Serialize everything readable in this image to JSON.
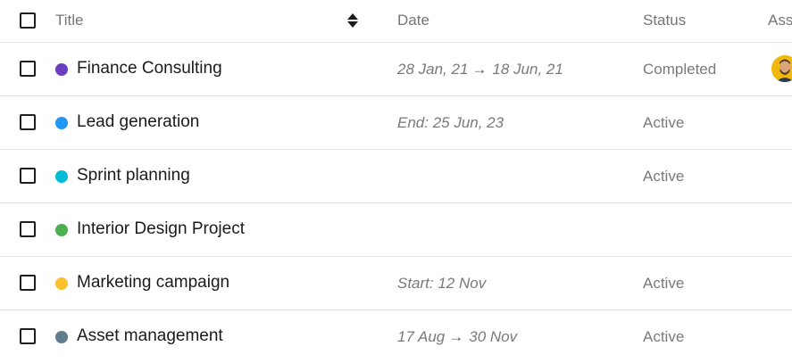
{
  "columns": {
    "title": "Title",
    "date": "Date",
    "status": "Status",
    "assignee": "Ass"
  },
  "rows": [
    {
      "title": "Finance Consulting",
      "dot_color": "#6a3fc1",
      "date_start": "28 Jan, 21",
      "date_arrow": "→",
      "date_end": "18 Jun, 21",
      "status": "Completed",
      "has_avatar": true
    },
    {
      "title": "Lead generation",
      "dot_color": "#2196f3",
      "date_text": "End: 25 Jun, 23",
      "status": "Active"
    },
    {
      "title": "Sprint planning",
      "dot_color": "#00bcd4",
      "status": "Active"
    },
    {
      "title": "Interior Design Project",
      "dot_color": "#4caf50"
    },
    {
      "title": "Marketing campaign",
      "dot_color": "#fbc02d",
      "date_text": "Start: 12 Nov",
      "status": "Active"
    },
    {
      "title": "Asset management",
      "dot_color": "#607d8b",
      "date_start": "17 Aug",
      "date_arrow": "→",
      "date_end": "30 Nov",
      "status": "Active"
    }
  ]
}
